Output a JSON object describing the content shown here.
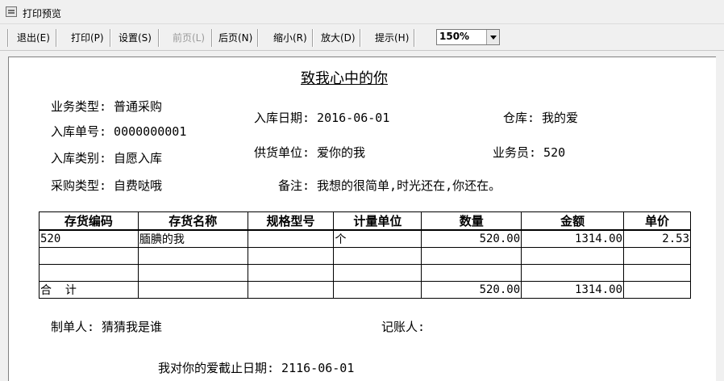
{
  "window": {
    "title": "打印预览"
  },
  "toolbar": {
    "exit": "退出(E)",
    "print": "打印(P)",
    "settings": "设置(S)",
    "prev": "前页(L)",
    "next": "后页(N)",
    "zoom_out": "缩小(R)",
    "zoom_in": "放大(D)",
    "hint": "提示(H)",
    "zoom_value": "150%"
  },
  "document": {
    "title": "致我心中的你",
    "fields": {
      "biz_type": "业务类型: 普通采购",
      "entry_no": "入库单号: 0000000001",
      "entry_date": "入库日期: 2016-06-01",
      "warehouse": "仓库: 我的爱",
      "entry_category": "入库类别: 自愿入库",
      "supplier": "供货单位: 爱你的我",
      "salesman": "业务员: 520",
      "purchase_type": "采购类型: 自费哒哦",
      "remark": "备注: 我想的很简单,时光还在,你还在。"
    },
    "table": {
      "headers": [
        "存货编码",
        "存货名称",
        "规格型号",
        "计量单位",
        "数量",
        "金额",
        "单价"
      ],
      "rows": [
        [
          "520",
          "腼腆的我",
          "",
          "个",
          "520.00",
          "1314.00",
          "2.53"
        ],
        [
          "",
          "",
          "",
          "",
          "",
          "",
          ""
        ],
        [
          "",
          "",
          "",
          "",
          "",
          "",
          ""
        ]
      ],
      "total": [
        "合  计",
        "",
        "",
        "",
        "520.00",
        "1314.00",
        ""
      ]
    },
    "footer": {
      "maker": "制单人: 猜猜我是谁",
      "bookkeeper": "记账人:",
      "deadline": "我对你的爱截止日期: 2116-06-01"
    }
  }
}
